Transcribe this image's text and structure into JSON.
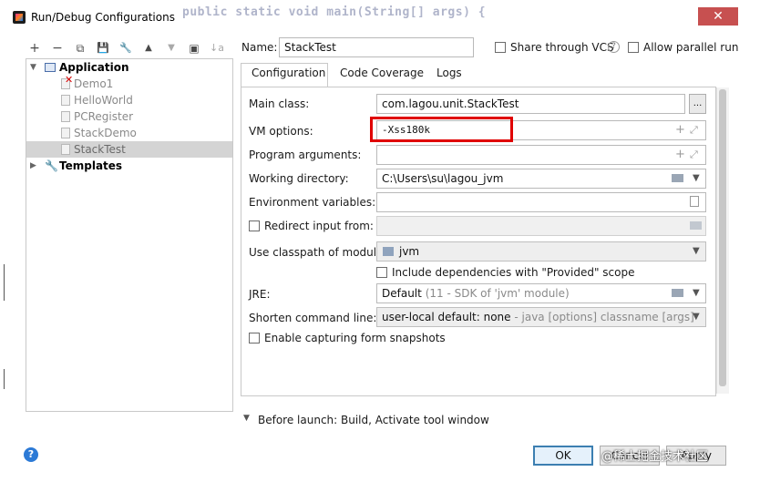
{
  "window": {
    "title": "Run/Debug Configurations",
    "bg_code": "public static void main(String[] args) {",
    "close_glyph": "✕"
  },
  "toolbar": {
    "add": "+",
    "remove": "−",
    "copy": "⧉",
    "save": "💾",
    "edit": "🔧",
    "up": "▲",
    "down": "▼",
    "move": "▣",
    "sort": "↓a"
  },
  "tree": {
    "application_label": "Application",
    "items": [
      "Demo1",
      "HelloWorld",
      "PCRegister",
      "StackDemo",
      "StackTest"
    ],
    "selected": "StackTest",
    "templates_label": "Templates"
  },
  "header": {
    "name_label": "Name:",
    "name_value": "StackTest",
    "share_label": "Share through VCS",
    "parallel_label": "Allow parallel run"
  },
  "tabs": [
    {
      "label": "Configuration",
      "active": true
    },
    {
      "label": "Code Coverage",
      "active": false
    },
    {
      "label": "Logs",
      "active": false
    }
  ],
  "form": {
    "main_class_label": "Main class:",
    "main_class_value": "com.lagou.unit.StackTest",
    "browse_btn": "...",
    "vm_options_label": "VM options:",
    "vm_options_value": "-Xss180k",
    "program_args_label": "Program arguments:",
    "program_args_value": "",
    "working_dir_label": "Working directory:",
    "working_dir_value": "C:\\Users\\su\\lagou_jvm",
    "env_vars_label": "Environment variables:",
    "env_vars_value": "",
    "redirect_label": "Redirect input from:",
    "classpath_label": "Use classpath of module:",
    "classpath_value": "jvm",
    "include_deps_label": "Include dependencies with \"Provided\" scope",
    "jre_label": "JRE:",
    "jre_value": "Default",
    "jre_hint": "(11 - SDK of 'jvm' module)",
    "shorten_label": "Shorten command line:",
    "shorten_value": "user-local default: none",
    "shorten_hint": "- java [options] classname [args]",
    "snapshots_label": "Enable capturing form snapshots"
  },
  "before_launch": {
    "label": "Before launch: Build, Activate tool window"
  },
  "buttons": {
    "ok": "OK",
    "cancel": "Cancel",
    "apply": "Apply"
  },
  "watermark": "@稀土掘金技术社区",
  "colors": {
    "highlight_box": "#e00000",
    "selection": "#d4d4d4",
    "help_blue": "#2c7ad6"
  }
}
